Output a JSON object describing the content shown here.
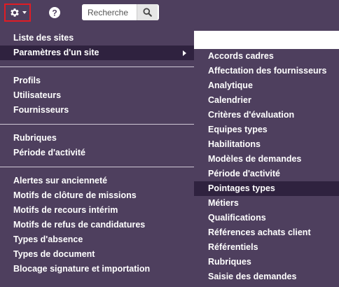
{
  "search": {
    "placeholder": "Recherche"
  },
  "menu": {
    "group1": [
      "Liste des sites",
      "Paramètres d'un site"
    ],
    "group2": [
      "Profils",
      "Utilisateurs",
      "Fournisseurs"
    ],
    "group3": [
      "Rubriques",
      "Période d'activité"
    ],
    "group4": [
      "Alertes sur ancienneté",
      "Motifs de clôture de missions",
      "Motifs de recours intérim",
      "Motifs de refus de candidatures",
      "Types d'absence",
      "Types de document",
      "Blocage signature et importation"
    ]
  },
  "submenu": {
    "items": [
      "Accords cadres",
      "Affectation des fournisseurs",
      "Analytique",
      "Calendrier",
      "Critères d'évaluation",
      "Equipes types",
      "Habilitations",
      "Modèles de demandes",
      "Période d'activité",
      "Pointages types",
      "Métiers",
      "Qualifications",
      "Références achats client",
      "Référentiels",
      "Rubriques",
      "Saisie des demandes"
    ],
    "active_index": 9
  },
  "icons": {
    "settings": "gear-icon",
    "help": "question-circle-icon",
    "search": "magnifier-icon",
    "submenu_arrow": "chevron-right-icon"
  },
  "colors": {
    "background": "#4e3f5e",
    "active": "#2f223f",
    "highlight_border": "#e01c24"
  }
}
